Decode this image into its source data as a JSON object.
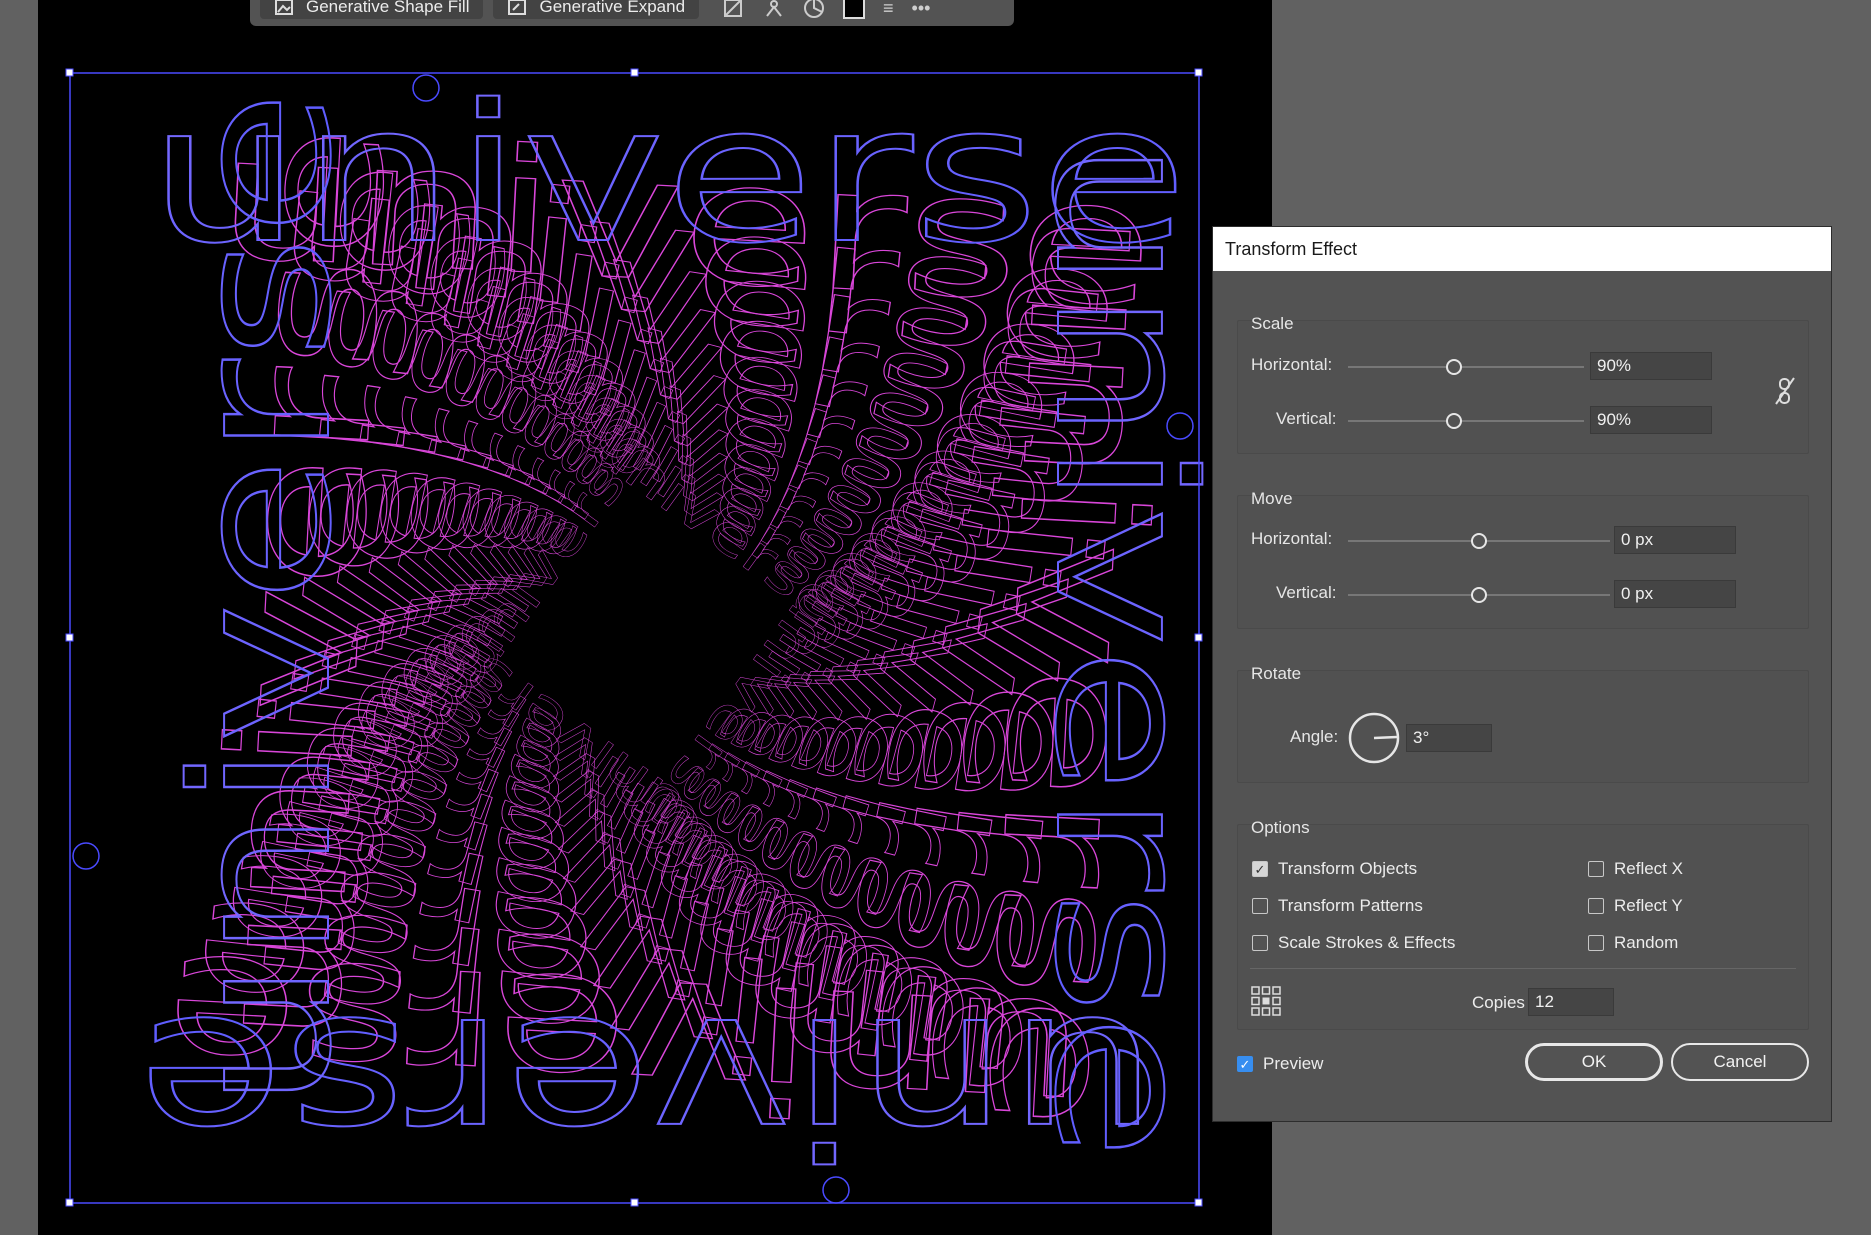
{
  "context_bar": {
    "generative_shape_fill_label": "Generative Shape Fill",
    "generative_expand_label": "Generative Expand",
    "more_glyph": "•••",
    "menu_glyph": "≡"
  },
  "artwork": {
    "word": "universe",
    "colors": {
      "outline_blue": "#6b6bff",
      "outline_magenta": "#d946d9",
      "selection": "#4a4aff"
    }
  },
  "dialog": {
    "title": "Transform Effect",
    "scale": {
      "label": "Scale",
      "horizontal_label": "Horizontal:",
      "horizontal_value": "90%",
      "vertical_label": "Vertical:",
      "vertical_value": "90%",
      "horizontal_level": 0.45,
      "vertical_level": 0.45
    },
    "move": {
      "label": "Move",
      "horizontal_label": "Horizontal:",
      "horizontal_value": "0 px",
      "vertical_label": "Vertical:",
      "vertical_value": "0 px",
      "horizontal_level": 0.5,
      "vertical_level": 0.5
    },
    "rotate": {
      "label": "Rotate",
      "angle_label": "Angle:",
      "angle_value": "3°"
    },
    "options": {
      "label": "Options",
      "transform_objects": {
        "label": "Transform Objects",
        "checked": true
      },
      "transform_patterns": {
        "label": "Transform Patterns",
        "checked": false
      },
      "scale_strokes": {
        "label": "Scale Strokes & Effects",
        "checked": false
      },
      "reflect_x": {
        "label": "Reflect X",
        "checked": false
      },
      "reflect_y": {
        "label": "Reflect Y",
        "checked": false
      },
      "random": {
        "label": "Random",
        "checked": false
      },
      "copies_label": "Copies",
      "copies_value": "12"
    },
    "preview": {
      "label": "Preview",
      "checked": true
    },
    "ok_label": "OK",
    "cancel_label": "Cancel"
  }
}
